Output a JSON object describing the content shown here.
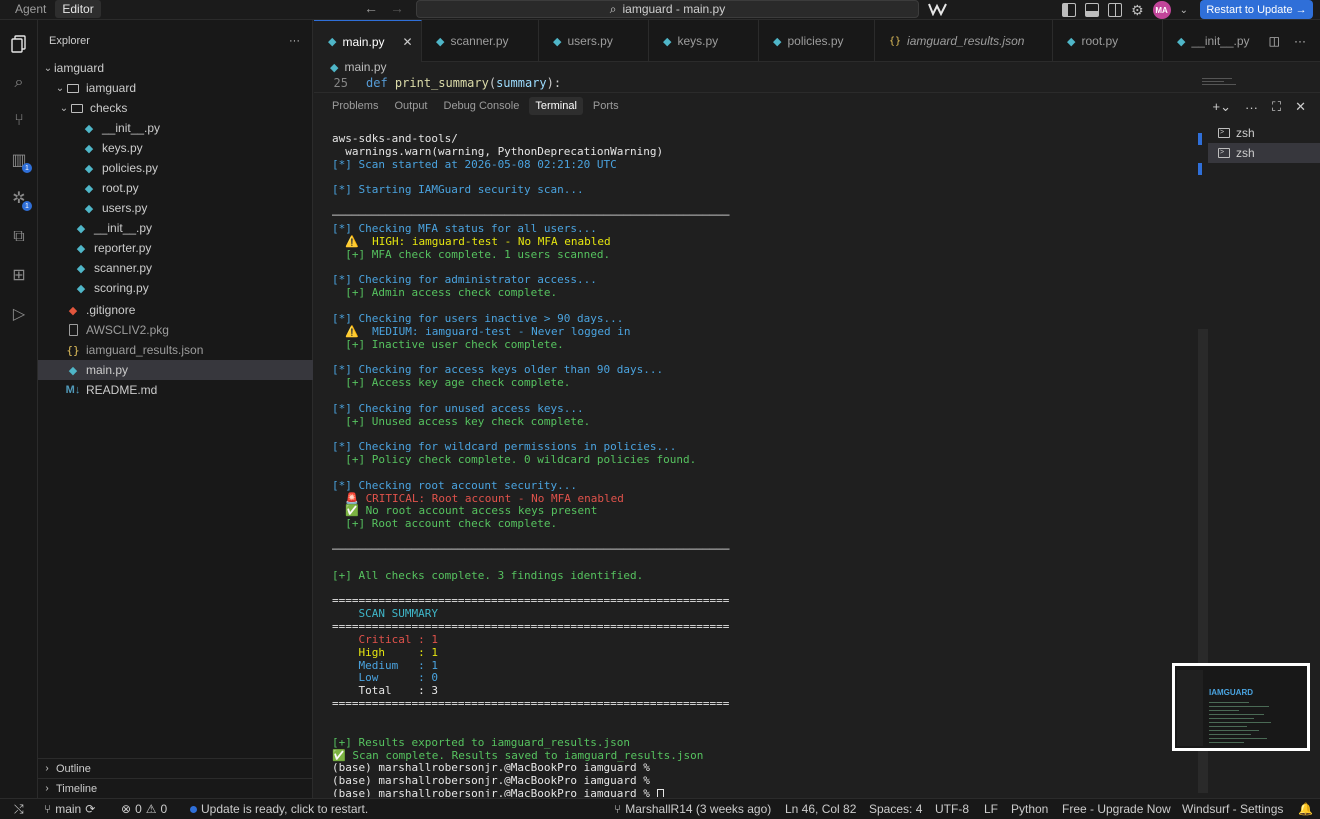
{
  "titlebar": {
    "mode_agent": "Agent",
    "mode_editor": "Editor",
    "search_text": "iamguard - main.py",
    "avatar_initials": "MA",
    "restart_label": "Restart to Update →"
  },
  "activity": {
    "badge_extensions": "1",
    "badge_ai": "1"
  },
  "sidebar": {
    "title": "Explorer",
    "more": "···",
    "tree": [
      {
        "label": "iamguard"
      },
      {
        "label": "iamguard"
      },
      {
        "label": "checks"
      },
      {
        "label": "__init__.py"
      },
      {
        "label": "keys.py"
      },
      {
        "label": "policies.py"
      },
      {
        "label": "root.py"
      },
      {
        "label": "users.py"
      },
      {
        "label": "__init__.py"
      },
      {
        "label": "reporter.py"
      },
      {
        "label": "scanner.py"
      },
      {
        "label": "scoring.py"
      },
      {
        "label": ".gitignore"
      },
      {
        "label": "AWSCLIV2.pkg"
      },
      {
        "label": "iamguard_results.json"
      },
      {
        "label": "main.py"
      },
      {
        "label": "README.md"
      }
    ],
    "outline": "Outline",
    "timeline": "Timeline"
  },
  "tabs": [
    {
      "label": "main.py"
    },
    {
      "label": "scanner.py"
    },
    {
      "label": "users.py"
    },
    {
      "label": "keys.py"
    },
    {
      "label": "policies.py"
    },
    {
      "label": "iamguard_results.json"
    },
    {
      "label": "root.py"
    },
    {
      "label": "__init__.py"
    }
  ],
  "breadcrumb": {
    "file": "main.py"
  },
  "code": {
    "line_number": "25",
    "kw": "def",
    "fn": "print_summary",
    "param": "summary",
    "tail": "):"
  },
  "panel": {
    "tabs": [
      "Problems",
      "Output",
      "Debug Console",
      "Terminal",
      "Ports"
    ]
  },
  "terminal": {
    "lines": [
      {
        "t": "aws-sdks-and-tools/",
        "c": "c-white"
      },
      {
        "t": "  warnings.warn(warning, PythonDeprecationWarning)",
        "c": "c-white"
      },
      {
        "t": "[*] Scan started at 2026-05-08 02:21:20 UTC",
        "c": "c-blue"
      },
      {
        "t": "",
        "c": ""
      },
      {
        "t": "[*] Starting IAMGuard security scan...",
        "c": "c-blue"
      },
      {
        "t": "",
        "c": ""
      },
      {
        "t": "────────────────────────────────────────────────────────────",
        "c": "c-grey"
      },
      {
        "t": "[*] Checking MFA status for all users...",
        "c": "c-blue"
      },
      {
        "t": "  ⚠️  HIGH: iamguard-test - No MFA enabled",
        "c": "c-yellow"
      },
      {
        "t": "  [+] MFA check complete. 1 users scanned.",
        "c": "c-green"
      },
      {
        "t": "",
        "c": ""
      },
      {
        "t": "[*] Checking for administrator access...",
        "c": "c-blue"
      },
      {
        "t": "  [+] Admin access check complete.",
        "c": "c-green"
      },
      {
        "t": "",
        "c": ""
      },
      {
        "t": "[*] Checking for users inactive > 90 days...",
        "c": "c-blue"
      },
      {
        "t": "  ⚠️  MEDIUM: iamguard-test - Never logged in",
        "c": "c-blue"
      },
      {
        "t": "  [+] Inactive user check complete.",
        "c": "c-green"
      },
      {
        "t": "",
        "c": ""
      },
      {
        "t": "[*] Checking for access keys older than 90 days...",
        "c": "c-blue"
      },
      {
        "t": "  [+] Access key age check complete.",
        "c": "c-green"
      },
      {
        "t": "",
        "c": ""
      },
      {
        "t": "[*] Checking for unused access keys...",
        "c": "c-blue"
      },
      {
        "t": "  [+] Unused access key check complete.",
        "c": "c-green"
      },
      {
        "t": "",
        "c": ""
      },
      {
        "t": "[*] Checking for wildcard permissions in policies...",
        "c": "c-blue"
      },
      {
        "t": "  [+] Policy check complete. 0 wildcard policies found.",
        "c": "c-green"
      },
      {
        "t": "",
        "c": ""
      },
      {
        "t": "[*] Checking root account security...",
        "c": "c-blue"
      },
      {
        "t": "  🚨 CRITICAL: Root account - No MFA enabled",
        "c": "c-red"
      },
      {
        "t": "  ✅ No root account access keys present",
        "c": "c-green"
      },
      {
        "t": "  [+] Root account check complete.",
        "c": "c-green"
      },
      {
        "t": "",
        "c": ""
      },
      {
        "t": "────────────────────────────────────────────────────────────",
        "c": "c-grey"
      },
      {
        "t": "",
        "c": ""
      },
      {
        "t": "[+] All checks complete. 3 findings identified.",
        "c": "c-green"
      },
      {
        "t": "",
        "c": ""
      },
      {
        "t": "============================================================",
        "c": "c-white"
      },
      {
        "t": "    SCAN SUMMARY",
        "c": "c-cyan"
      },
      {
        "t": "============================================================",
        "c": "c-white"
      },
      {
        "t": "    Critical : 1",
        "c": "c-red"
      },
      {
        "t": "    High     : 1",
        "c": "c-yellow"
      },
      {
        "t": "    Medium   : 1",
        "c": "c-blue"
      },
      {
        "t": "    Low      : 0",
        "c": "c-blue"
      },
      {
        "t": "    Total    : 3",
        "c": "c-white"
      },
      {
        "t": "============================================================",
        "c": "c-white"
      },
      {
        "t": "",
        "c": ""
      },
      {
        "t": "",
        "c": ""
      },
      {
        "t": "[+] Results exported to iamguard_results.json",
        "c": "c-green"
      },
      {
        "t": "✅ Scan complete. Results saved to iamguard_results.json",
        "c": "c-green"
      },
      {
        "t": "(base) marshallrobersonjr.@MacBookPro iamguard %",
        "c": "c-white"
      },
      {
        "t": "(base) marshallrobersonjr.@MacBookPro iamguard %",
        "c": "c-white"
      },
      {
        "t": "(base) marshallrobersonjr.@MacBookPro iamguard % ",
        "c": "c-white",
        "cursor": true
      }
    ]
  },
  "terminal_list": [
    "zsh",
    "zsh"
  ],
  "minimap": {
    "title": "IAMGUARD"
  },
  "status": {
    "branch": "main",
    "errors": "0",
    "warnings": "0",
    "update_msg": "Update is ready, click to restart.",
    "blame": "MarshallR14 (3 weeks ago)",
    "position": "Ln 46, Col 82",
    "spaces": "Spaces: 4",
    "encoding": "UTF-8",
    "eol": "LF",
    "language": "Python",
    "upgrade": "Free - Upgrade Now",
    "settings": "Windsurf - Settings"
  },
  "colors": {
    "accent": "#2f6fd8",
    "critical": "#e0524b",
    "high": "#e5e510",
    "medium": "#4aa3df",
    "ok": "#56c25f"
  }
}
